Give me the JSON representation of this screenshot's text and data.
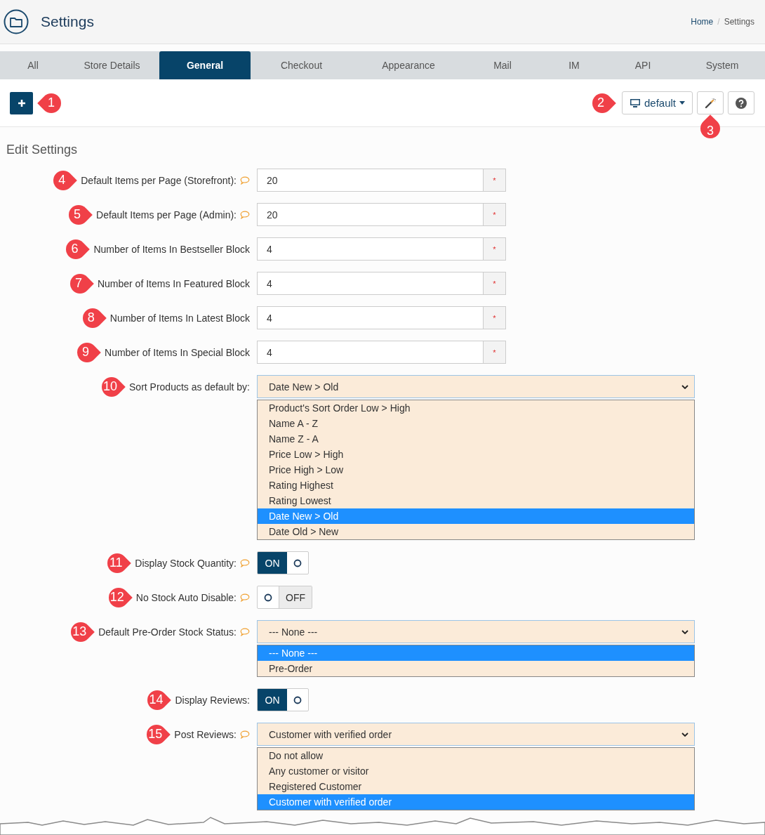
{
  "header": {
    "title": "Settings",
    "breadcrumb": [
      "Home",
      "Settings"
    ],
    "separator": "/"
  },
  "tabs": [
    {
      "label": "All",
      "selected": false
    },
    {
      "label": "Store Details",
      "selected": false
    },
    {
      "label": "General",
      "selected": true
    },
    {
      "label": "Checkout",
      "selected": false
    },
    {
      "label": "Appearance",
      "selected": false
    },
    {
      "label": "Mail",
      "selected": false
    },
    {
      "label": "IM",
      "selected": false
    },
    {
      "label": "API",
      "selected": false
    },
    {
      "label": "System",
      "selected": false
    }
  ],
  "toolbar": {
    "add_callout": "1",
    "theme_label": "default",
    "theme_callout": "2",
    "wand_callout": "3"
  },
  "section_title": "Edit Settings",
  "settings": [
    {
      "kind": "text",
      "callout": "4",
      "label": "Default Items per Page (Storefront):",
      "help": true,
      "value": "20",
      "required_mark": "*"
    },
    {
      "kind": "text",
      "callout": "5",
      "label": "Default Items per Page (Admin):",
      "help": true,
      "value": "20",
      "required_mark": "*"
    },
    {
      "kind": "text",
      "callout": "6",
      "label": "Number of Items In Bestseller Block",
      "help": false,
      "value": "4",
      "required_mark": "*"
    },
    {
      "kind": "text",
      "callout": "7",
      "label": "Number of Items In Featured Block",
      "help": false,
      "value": "4",
      "required_mark": "*"
    },
    {
      "kind": "text",
      "callout": "8",
      "label": "Number of Items In Latest Block",
      "help": false,
      "value": "4",
      "required_mark": "*"
    },
    {
      "kind": "text",
      "callout": "9",
      "label": "Number of Items In Special Block",
      "help": false,
      "value": "4",
      "required_mark": "*"
    },
    {
      "kind": "select",
      "callout": "10",
      "label": "Sort Products as default by:",
      "help": false,
      "value": "Date New > Old",
      "expanded": true,
      "options": [
        {
          "label": "Product's Sort Order Low > High",
          "selected": false
        },
        {
          "label": "Name A - Z",
          "selected": false
        },
        {
          "label": "Name Z - A",
          "selected": false
        },
        {
          "label": "Price Low > High",
          "selected": false
        },
        {
          "label": "Price High > Low",
          "selected": false
        },
        {
          "label": "Rating Highest",
          "selected": false
        },
        {
          "label": "Rating Lowest",
          "selected": false
        },
        {
          "label": "Date New > Old",
          "selected": true
        },
        {
          "label": "Date Old > New",
          "selected": false
        }
      ]
    },
    {
      "kind": "toggle",
      "callout": "11",
      "label": "Display Stock Quantity:",
      "help": true,
      "on": true,
      "state_text": "ON"
    },
    {
      "kind": "toggle",
      "callout": "12",
      "label": "No Stock Auto Disable:",
      "help": true,
      "on": false,
      "state_text": "OFF"
    },
    {
      "kind": "select",
      "callout": "13",
      "label": "Default Pre-Order Stock Status:",
      "help": true,
      "value": "--- None ---",
      "expanded": true,
      "options": [
        {
          "label": "--- None ---",
          "selected": true
        },
        {
          "label": "Pre-Order",
          "selected": false
        }
      ]
    },
    {
      "kind": "toggle",
      "callout": "14",
      "label": "Display Reviews:",
      "help": false,
      "on": true,
      "state_text": "ON"
    },
    {
      "kind": "select",
      "callout": "15",
      "label": "Post Reviews:",
      "help": true,
      "value": "Customer with verified order",
      "expanded": true,
      "options": [
        {
          "label": "Do not allow",
          "selected": false
        },
        {
          "label": "Any customer or visitor",
          "selected": false
        },
        {
          "label": "Registered Customer",
          "selected": false
        },
        {
          "label": "Customer with verified order",
          "selected": true
        }
      ]
    }
  ]
}
